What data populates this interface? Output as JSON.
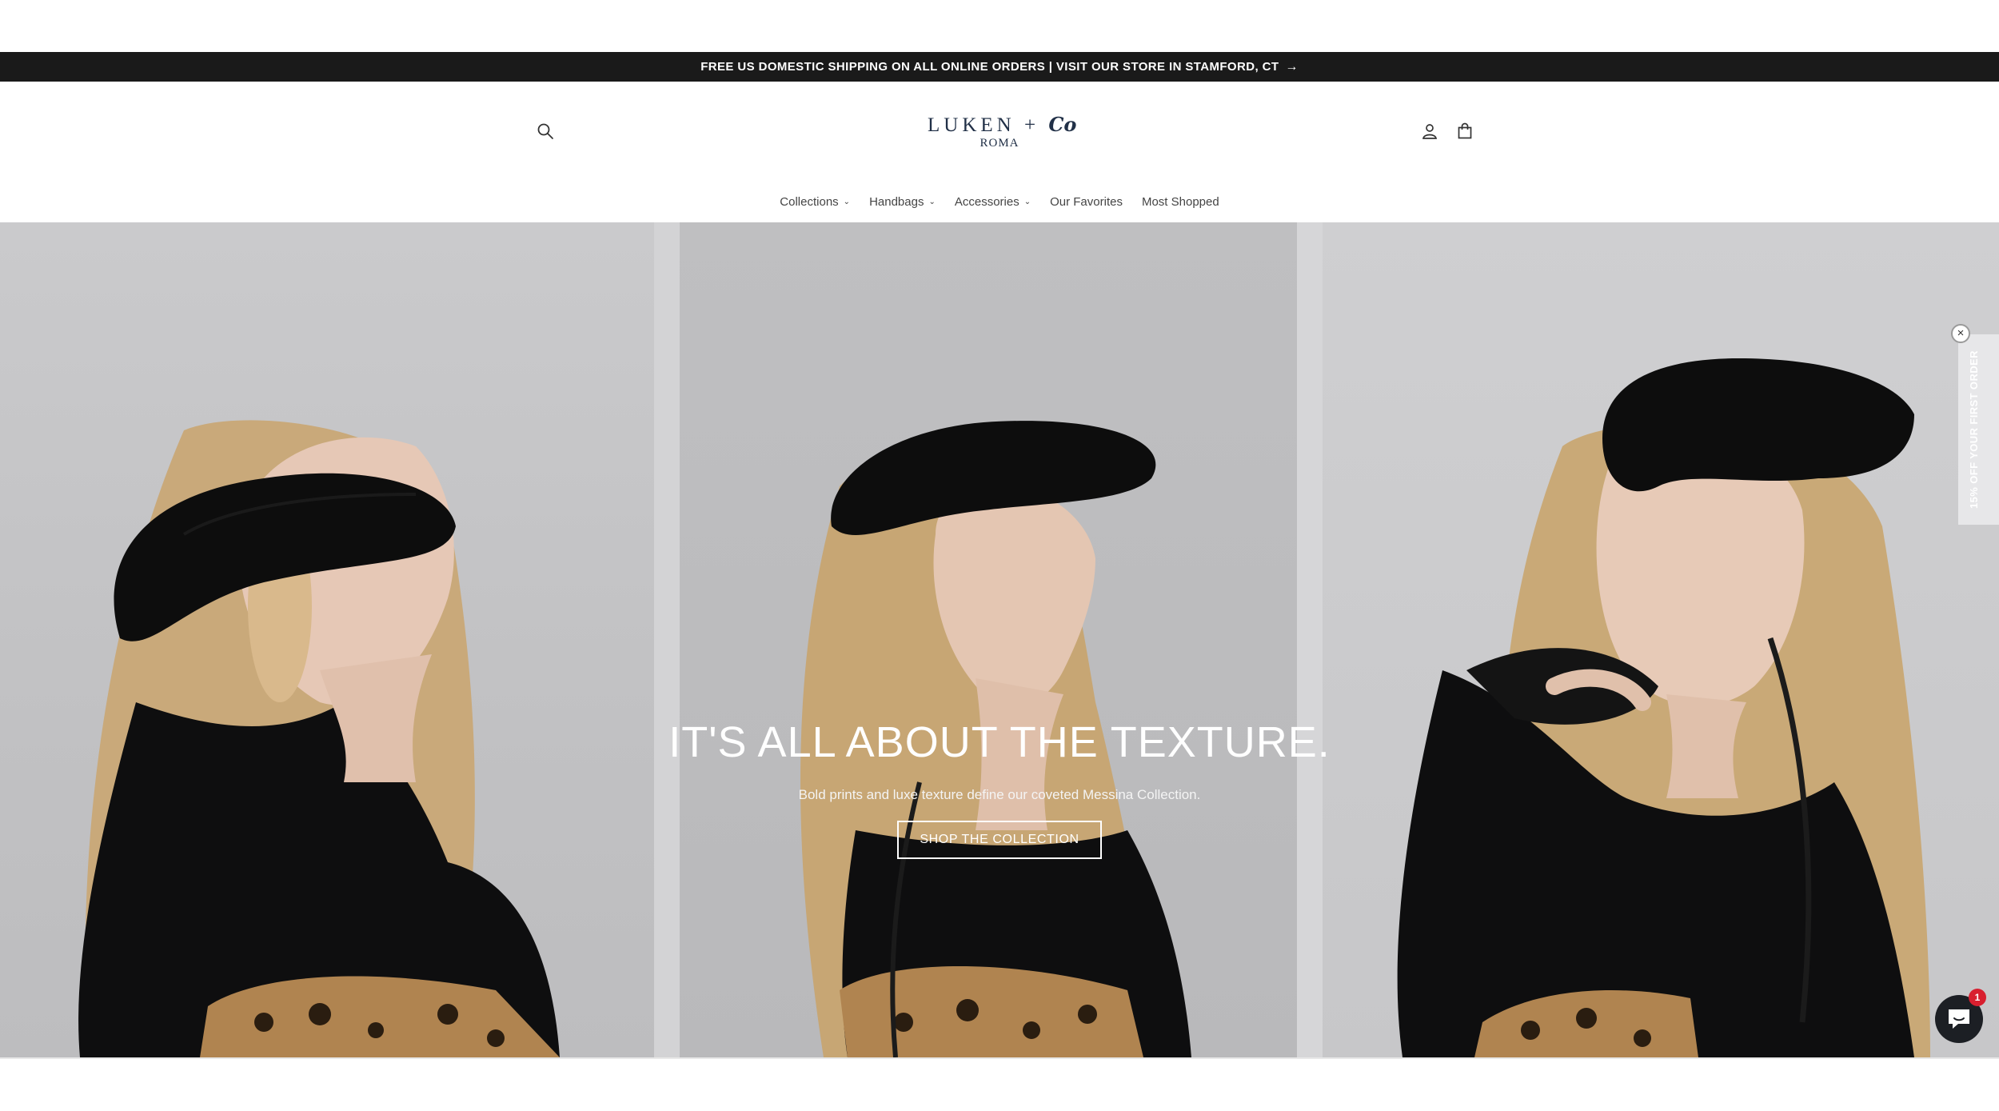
{
  "announcement": {
    "text": "FREE US DOMESTIC SHIPPING ON ALL ONLINE ORDERS | VISIT OUR STORE IN STAMFORD, CT",
    "arrow": "→"
  },
  "header": {
    "logo_main": "LUKEN +",
    "logo_script": "Co",
    "logo_sub": "ROMA",
    "icons": [
      "search-icon",
      "account-icon",
      "cart-icon"
    ]
  },
  "nav": {
    "items": [
      {
        "label": "Collections",
        "has_dropdown": true
      },
      {
        "label": "Handbags",
        "has_dropdown": true
      },
      {
        "label": "Accessories",
        "has_dropdown": true
      },
      {
        "label": "Our Favorites",
        "has_dropdown": false
      },
      {
        "label": "Most Shopped",
        "has_dropdown": false
      }
    ]
  },
  "hero": {
    "title": "IT'S ALL ABOUT THE TEXTURE.",
    "subtitle": "Bold prints and luxe texture define our coveted Messina Collection.",
    "button_label": "SHOP THE COLLECTION"
  },
  "promo_tab": {
    "text": "15% OFF YOUR FIRST ORDER",
    "close": "×"
  },
  "chat": {
    "badge_count": "1"
  },
  "colors": {
    "announcement_bg": "#1a1a1a",
    "logo": "#213047",
    "chat_bg": "#1c1f24",
    "badge": "#d81f2f"
  }
}
